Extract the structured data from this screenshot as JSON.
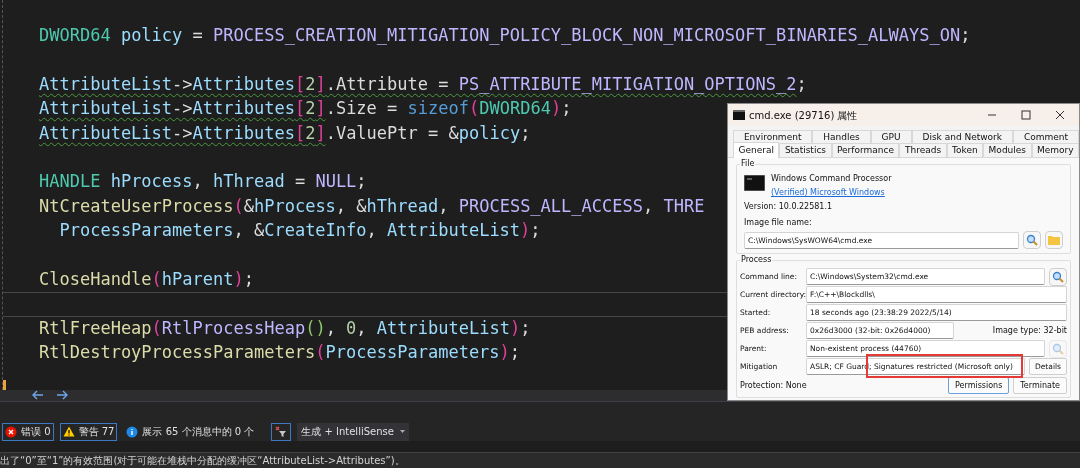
{
  "editor": {
    "blocks": [
      {
        "current_line_after": false,
        "lines": [
          [
            {
              "t": "DWORD64",
              "kind": "type"
            },
            {
              "t": " policy",
              "kind": "var"
            },
            {
              "t": " = ",
              "kind": "op"
            },
            {
              "t": "PROCESS_CREATION_MITIGATION_POLICY_BLOCK_NON_MICROSOFT_BINARIES_ALWAYS_ON",
              "kind": "macro"
            },
            {
              "t": ";",
              "kind": "op"
            }
          ]
        ]
      },
      {
        "current_line_after": false,
        "lines": [
          [
            {
              "t": "AttributeList",
              "kind": "var",
              "squiggle": true
            },
            {
              "t": "->",
              "kind": "op",
              "squiggle": true
            },
            {
              "t": "Attributes",
              "kind": "var",
              "squiggle": true
            },
            {
              "t": "[",
              "kind": "bracket",
              "squiggle": true
            },
            {
              "t": "2",
              "kind": "number",
              "squiggle": true
            },
            {
              "t": "]",
              "kind": "bracket",
              "squiggle": true
            },
            {
              "t": ".Attribute = ",
              "kind": "op",
              "squiggle": true
            },
            {
              "t": "PS_ATTRIBUTE_MITIGATION_OPTIONS_2",
              "kind": "macro",
              "squiggle": true
            },
            {
              "t": ";",
              "kind": "op",
              "squiggle": false
            }
          ],
          [
            {
              "t": "AttributeList",
              "kind": "var",
              "squiggle": true
            },
            {
              "t": "->",
              "kind": "op",
              "squiggle": true
            },
            {
              "t": "Attributes",
              "kind": "var",
              "squiggle": true
            },
            {
              "t": "[",
              "kind": "bracket",
              "squiggle": true
            },
            {
              "t": "2",
              "kind": "number",
              "squiggle": true
            },
            {
              "t": "]",
              "kind": "bracket",
              "squiggle": true
            },
            {
              "t": ".Size = ",
              "kind": "op",
              "squiggle": false
            },
            {
              "t": "sizeof",
              "kind": "keyword",
              "squiggle": false
            },
            {
              "t": "(",
              "kind": "bracket",
              "squiggle": false
            },
            {
              "t": "DWORD64",
              "kind": "type",
              "squiggle": false
            },
            {
              "t": ")",
              "kind": "bracket",
              "squiggle": false
            },
            {
              "t": ";",
              "kind": "op",
              "squiggle": false
            }
          ],
          [
            {
              "t": "AttributeList",
              "kind": "var",
              "squiggle": true
            },
            {
              "t": "->",
              "kind": "op",
              "squiggle": true
            },
            {
              "t": "Attributes",
              "kind": "var",
              "squiggle": true
            },
            {
              "t": "[",
              "kind": "bracket",
              "squiggle": true
            },
            {
              "t": "2",
              "kind": "number",
              "squiggle": true
            },
            {
              "t": "]",
              "kind": "bracket",
              "squiggle": true
            },
            {
              "t": ".ValuePtr = &",
              "kind": "op",
              "squiggle": false
            },
            {
              "t": "policy",
              "kind": "var",
              "squiggle": false
            },
            {
              "t": ";",
              "kind": "op",
              "squiggle": false
            }
          ]
        ]
      },
      {
        "current_line_after": false,
        "lines": [
          [
            {
              "t": "HANDLE",
              "kind": "type"
            },
            {
              "t": " hProcess",
              "kind": "var"
            },
            {
              "t": ", ",
              "kind": "op"
            },
            {
              "t": "hThread",
              "kind": "var"
            },
            {
              "t": " = ",
              "kind": "op"
            },
            {
              "t": "NULL",
              "kind": "macro"
            },
            {
              "t": ";",
              "kind": "op"
            }
          ],
          [
            {
              "t": "NtCreateUserProcess",
              "kind": "func"
            },
            {
              "t": "(",
              "kind": "bracket"
            },
            {
              "t": "&",
              "kind": "op"
            },
            {
              "t": "hProcess",
              "kind": "var"
            },
            {
              "t": ", &",
              "kind": "op"
            },
            {
              "t": "hThread",
              "kind": "var"
            },
            {
              "t": ", ",
              "kind": "op"
            },
            {
              "t": "PROCESS_ALL_ACCESS",
              "kind": "macro"
            },
            {
              "t": ", ",
              "kind": "op"
            },
            {
              "t": "THRE",
              "kind": "macro"
            }
          ],
          [
            {
              "t": "  ProcessParameters",
              "kind": "var"
            },
            {
              "t": ", &",
              "kind": "op"
            },
            {
              "t": "CreateInfo",
              "kind": "var"
            },
            {
              "t": ", ",
              "kind": "op"
            },
            {
              "t": "AttributeList",
              "kind": "var"
            },
            {
              "t": ")",
              "kind": "bracket"
            },
            {
              "t": ";",
              "kind": "op"
            }
          ]
        ]
      },
      {
        "current_line_after": true,
        "lines": [
          [
            {
              "t": "CloseHandle",
              "kind": "func"
            },
            {
              "t": "(",
              "kind": "bracket"
            },
            {
              "t": "hParent",
              "kind": "var"
            },
            {
              "t": ")",
              "kind": "bracket"
            },
            {
              "t": ";",
              "kind": "op"
            }
          ]
        ]
      },
      {
        "current_line_after": false,
        "lines": [
          [
            {
              "t": "RtlFreeHeap",
              "kind": "func"
            },
            {
              "t": "(",
              "kind": "bracket"
            },
            {
              "t": "RtlProcessHeap",
              "kind": "macro"
            },
            {
              "t": "()",
              "kind": "bracket2"
            },
            {
              "t": ", ",
              "kind": "op"
            },
            {
              "t": "0",
              "kind": "number"
            },
            {
              "t": ", ",
              "kind": "op"
            },
            {
              "t": "AttributeList",
              "kind": "var"
            },
            {
              "t": ")",
              "kind": "bracket"
            },
            {
              "t": ";",
              "kind": "op"
            }
          ],
          [
            {
              "t": "RtlDestroyProcessParameters",
              "kind": "func"
            },
            {
              "t": "(",
              "kind": "bracket"
            },
            {
              "t": "ProcessParameters",
              "kind": "var"
            },
            {
              "t": ")",
              "kind": "bracket"
            },
            {
              "t": ";",
              "kind": "op"
            }
          ]
        ]
      }
    ]
  },
  "error_list": {
    "errors": {
      "label": "错误 0",
      "on": true
    },
    "warnings": {
      "label": "警告 77",
      "on": true
    },
    "messages": {
      "label": "展示 65 个消息中的 0 个",
      "on": false
    },
    "filter": {
      "on": true
    },
    "scope": "生成 + IntelliSense"
  },
  "status_bar": "出了“0”至“1”的有效范围(对于可能在堆栈中分配的缓冲区“AttributeList->Attributes”)。",
  "dialog": {
    "title": "cmd.exe (29716) 属性",
    "tabs_back": [
      {
        "label": "Environment",
        "selected": false
      },
      {
        "label": "Handles",
        "selected": false
      },
      {
        "label": "GPU",
        "selected": false
      },
      {
        "label": "Disk and Network",
        "selected": false
      },
      {
        "label": "Comment",
        "selected": false
      }
    ],
    "tabs_front": [
      {
        "label": "General",
        "selected": true
      },
      {
        "label": "Statistics",
        "selected": false
      },
      {
        "label": "Performance",
        "selected": false
      },
      {
        "label": "Threads",
        "selected": false
      },
      {
        "label": "Token",
        "selected": false
      },
      {
        "label": "Modules",
        "selected": false
      },
      {
        "label": "Memory",
        "selected": false
      }
    ],
    "file": {
      "heading": "File",
      "description": "Windows Command Processor",
      "verified": "(Verified) Microsoft Windows",
      "version": "Version: 10.0.22581.1",
      "image_label": "Image file name:",
      "image_path": "C:\\Windows\\SysWOW64\\cmd.exe"
    },
    "process": {
      "heading": "Process",
      "rows": [
        {
          "label": "Command line:",
          "value": "C:\\Windows\\System32\\cmd.exe",
          "kind": "search"
        },
        {
          "label": "Current directory:",
          "value": "F:\\C++\\Blockdlls\\",
          "kind": "plain"
        },
        {
          "label": "Started:",
          "value": "18 seconds ago (23:38:29 2022/5/14)",
          "kind": "plain"
        },
        {
          "label": "PEB address:",
          "value": "0x26d3000 (32-bit: 0x26d4000)",
          "kind": "extra",
          "extra": "Image type: 32-bit"
        },
        {
          "label": "Parent:",
          "value": "Non-existent process (44760)",
          "kind": "search_disabled"
        },
        {
          "label": "Mitigation",
          "value": "ASLR; CF Guard; Signatures restricted (Microsoft only)",
          "kind": "button",
          "button": "Details"
        }
      ],
      "protection": "Protection: None",
      "buttons": [
        "Permissions",
        "Terminate"
      ]
    }
  }
}
